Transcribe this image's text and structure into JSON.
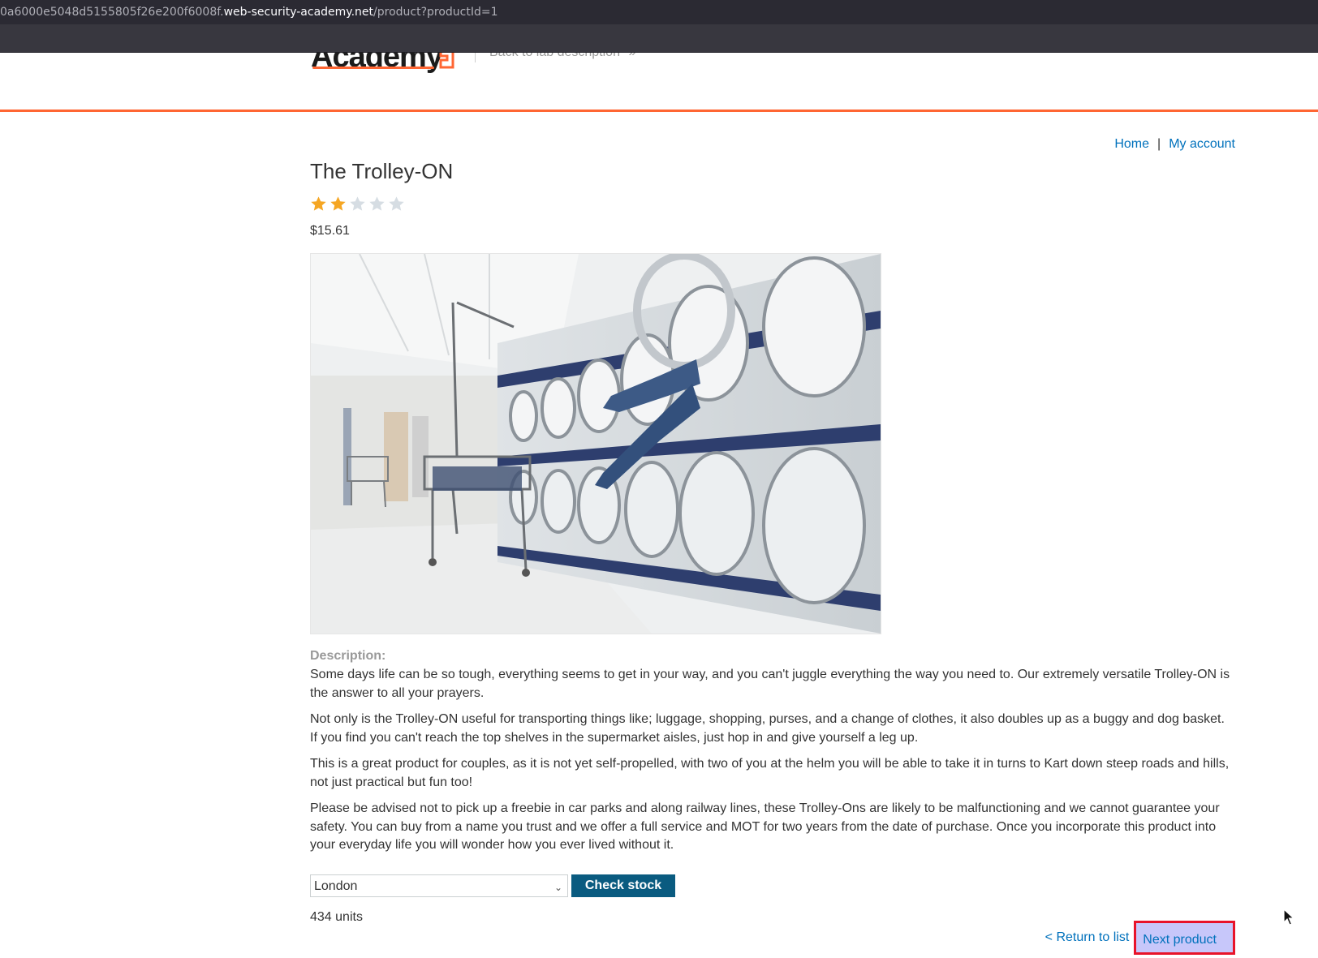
{
  "browser": {
    "url_prefix": "0a6000e5048d5155805f26e200f6008f.",
    "url_host": "web-security-academy.net",
    "url_path": "/product?productId=1"
  },
  "header": {
    "logo_text": "Academy",
    "back_link": "Back to lab description",
    "back_arrow": "»",
    "accent_color": "#ff6633"
  },
  "nav": {
    "home": "Home",
    "separator": "|",
    "my_account": "My account"
  },
  "product": {
    "title": "The Trolley-ON",
    "rating": 2,
    "rating_max": 5,
    "price": "$15.61",
    "image_subject": "laundromat-with-person-climbing-into-washing-machine"
  },
  "description": {
    "label": "Description:",
    "paragraphs": [
      "Some days life can be so tough, everything seems to get in your way, and you can't juggle everything the way you need to. Our extremely versatile Trolley-ON is the answer to all your prayers.",
      "Not only is the Trolley-ON useful for transporting things like; luggage, shopping, purses, and a change of clothes, it also doubles up as a buggy and dog basket. If you find you can't reach the top shelves in the supermarket aisles, just hop in and give yourself a leg up.",
      "This is a great product for couples, as it is not yet self-propelled, with two of you at the helm you will be able to take it in turns to Kart down steep roads and hills, not just practical but fun too!",
      "Please be advised not to pick up a freebie in car parks and along railway lines, these Trolley-Ons are likely to be malfunctioning and we cannot guarantee your safety. You can buy from a name you trust and we offer a full service and MOT for two years from the date of purchase. Once you incorporate this product into your everyday life you will wonder how you ever lived without it."
    ]
  },
  "stock": {
    "selected_store": "London",
    "check_button": "Check stock",
    "result": "434 units"
  },
  "footer_nav": {
    "return_link": "< Return to list",
    "next_link": "Next product"
  },
  "colors": {
    "link": "#0071bc",
    "button_bg": "#0a5b80",
    "star_on": "#f5a623",
    "star_off": "#d6dde3",
    "highlight_bg": "#c7c7fa",
    "highlight_border": "#e8132a"
  }
}
